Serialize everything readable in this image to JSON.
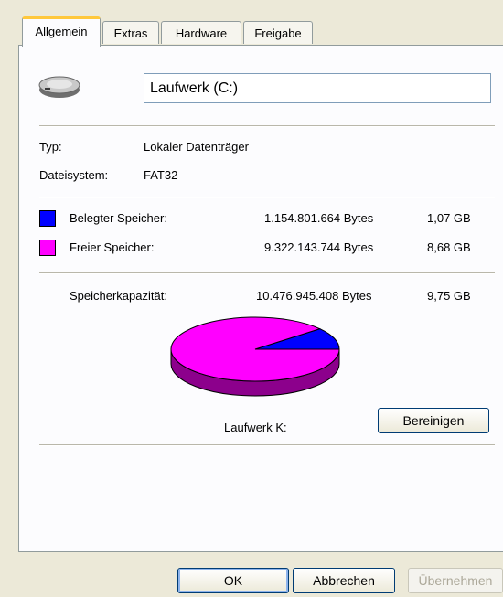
{
  "tabs": [
    {
      "label": "Allgemein",
      "active": true
    },
    {
      "label": "Extras"
    },
    {
      "label": "Hardware"
    },
    {
      "label": "Freigabe"
    }
  ],
  "drive": {
    "icon": "hard-drive-icon",
    "name_value": "Laufwerk (C:)"
  },
  "info": {
    "type_label": "Typ:",
    "type_value": "Lokaler Datenträger",
    "fs_label": "Dateisystem:",
    "fs_value": "FAT32"
  },
  "space": {
    "used": {
      "label": "Belegter Speicher:",
      "bytes": "1.154.801.664 Bytes",
      "gb": "1,07 GB",
      "color": "#0000ff"
    },
    "free": {
      "label": "Freier Speicher:",
      "bytes": "9.322.143.744 Bytes",
      "gb": "8,68 GB",
      "color": "#ff00ff"
    },
    "capacity": {
      "label": "Speicherkapazität:",
      "bytes": "10.476.945.408 Bytes",
      "gb": "9,75 GB"
    }
  },
  "chart_data": {
    "type": "pie",
    "slices": [
      {
        "value": 1154801664,
        "color": "#0000ff"
      },
      {
        "value": 9322143744,
        "color": "#ff00ff"
      }
    ]
  },
  "drive_label": "Laufwerk K:",
  "cleanup_label": "Bereinigen",
  "footer": {
    "ok_label": "OK",
    "cancel_label": "Abbrechen",
    "apply_label": "Übernehmen"
  }
}
